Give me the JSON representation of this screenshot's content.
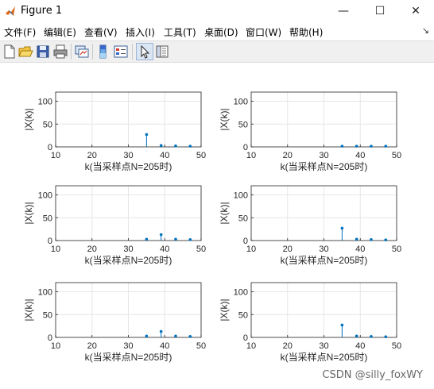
{
  "window": {
    "title": "Figure 1",
    "minimize": "—",
    "maximize": "☐",
    "close": "✕"
  },
  "menu": {
    "items": [
      "文件(F)",
      "编辑(E)",
      "查看(V)",
      "插入(I)",
      "工具(T)",
      "桌面(D)",
      "窗口(W)",
      "帮助(H)"
    ],
    "dock_arrow": "↘"
  },
  "toolbar": {
    "icons": [
      "new-figure-icon",
      "open-file-icon",
      "save-icon",
      "print-icon",
      "link-plot-icon",
      "colorbar-icon",
      "legend-icon",
      "pointer-icon",
      "property-editor-icon"
    ]
  },
  "chart_data": [
    {
      "type": "stem",
      "x": [
        35,
        39,
        43,
        47
      ],
      "values": [
        27,
        3,
        2,
        1.5
      ],
      "xlabel": "k(当采样点N=205时)",
      "ylabel": "|X(k)|",
      "xlim": [
        10,
        50
      ],
      "ylim": [
        0,
        120
      ],
      "xticks": [
        "10",
        "20",
        "30",
        "40",
        "50"
      ],
      "yticks": [
        "0",
        "50",
        "100"
      ],
      "grid": true,
      "color": "#0072BD"
    },
    {
      "type": "stem",
      "x": [
        35,
        39,
        43,
        47
      ],
      "values": [
        1.5,
        1.5,
        1.5,
        1.5
      ],
      "xlabel": "k(当采样点N=205时)",
      "ylabel": "|X(k)|",
      "xlim": [
        10,
        50
      ],
      "ylim": [
        0,
        120
      ],
      "xticks": [
        "10",
        "20",
        "30",
        "40",
        "50"
      ],
      "yticks": [
        "0",
        "50",
        "100"
      ],
      "grid": true,
      "color": "#0072BD"
    },
    {
      "type": "stem",
      "x": [
        35,
        39,
        43,
        47
      ],
      "values": [
        3,
        13,
        3,
        2
      ],
      "xlabel": "k(当采样点N=205时)",
      "ylabel": "|X(k)|",
      "xlim": [
        10,
        50
      ],
      "ylim": [
        0,
        120
      ],
      "xticks": [
        "10",
        "20",
        "30",
        "40",
        "50"
      ],
      "yticks": [
        "0",
        "50",
        "100"
      ],
      "grid": true,
      "color": "#0072BD"
    },
    {
      "type": "stem",
      "x": [
        35,
        39,
        43,
        47
      ],
      "values": [
        27,
        3,
        2,
        1.5
      ],
      "xlabel": "k(当采样点N=205时)",
      "ylabel": "|X(k)|",
      "xlim": [
        10,
        50
      ],
      "ylim": [
        0,
        120
      ],
      "xticks": [
        "10",
        "20",
        "30",
        "40",
        "50"
      ],
      "yticks": [
        "0",
        "50",
        "100"
      ],
      "grid": true,
      "color": "#0072BD"
    },
    {
      "type": "stem",
      "x": [
        35,
        39,
        43,
        47
      ],
      "values": [
        3,
        13,
        3,
        2
      ],
      "xlabel": "k(当采样点N=205时)",
      "ylabel": "|X(k)|",
      "xlim": [
        10,
        50
      ],
      "ylim": [
        0,
        120
      ],
      "xticks": [
        "10",
        "20",
        "30",
        "40",
        "50"
      ],
      "yticks": [
        "0",
        "50",
        "100"
      ],
      "grid": true,
      "color": "#0072BD"
    },
    {
      "type": "stem",
      "x": [
        35,
        39,
        43,
        47
      ],
      "values": [
        27,
        3,
        2,
        1.5
      ],
      "xlabel": "k(当采样点N=205时)",
      "ylabel": "|X(k)|",
      "xlim": [
        10,
        50
      ],
      "ylim": [
        0,
        120
      ],
      "xticks": [
        "10",
        "20",
        "30",
        "40",
        "50"
      ],
      "yticks": [
        "0",
        "50",
        "100"
      ],
      "grid": true,
      "color": "#0072BD"
    }
  ],
  "watermark": "CSDN @silly_foxWY"
}
